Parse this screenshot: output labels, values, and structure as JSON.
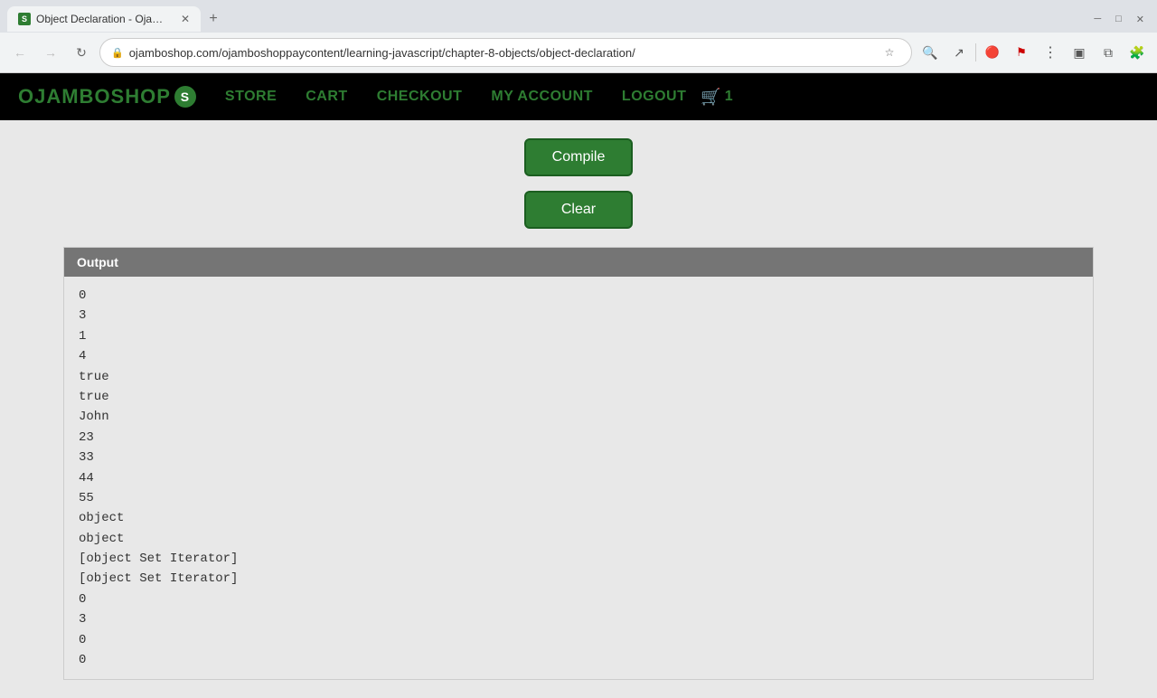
{
  "browser": {
    "tab_title": "Object Declaration - Ojamb...",
    "tab_favicon": "S",
    "url": "ojamboshop.com/ojamboshoppaycontent/learning-javascript/chapter-8-objects/object-declaration/",
    "new_tab_label": "+",
    "back_disabled": false,
    "forward_disabled": false
  },
  "nav": {
    "logo_text": "OJAMBOSHOP",
    "logo_letter": "S",
    "links": [
      "STORE",
      "CART",
      "CHECKOUT",
      "MY ACCOUNT",
      "LOGOUT"
    ],
    "cart_count": "1"
  },
  "buttons": {
    "compile": "Compile",
    "clear": "Clear"
  },
  "output": {
    "header": "Output",
    "lines": [
      "0",
      "3",
      "1",
      "4",
      "true",
      "true",
      "John",
      "23",
      "33",
      "44",
      "55",
      "object",
      "object",
      "[object Set Iterator]",
      "[object Set Iterator]",
      "0",
      "3",
      "0",
      "0"
    ]
  }
}
